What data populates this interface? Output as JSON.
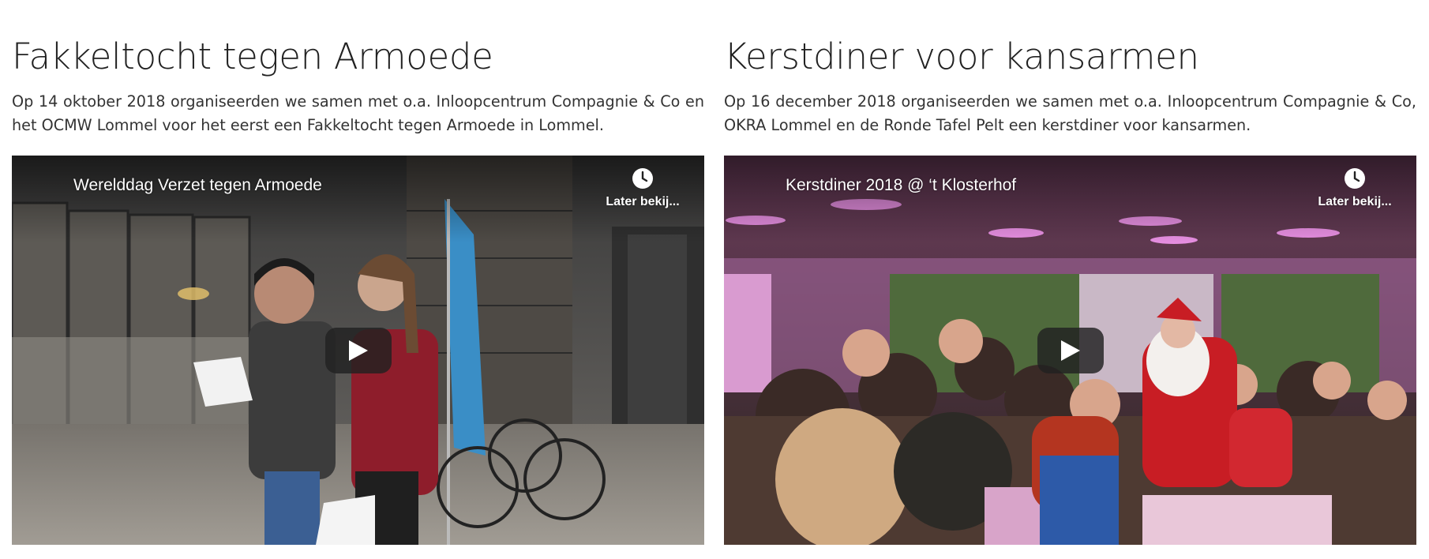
{
  "articles": [
    {
      "title": "Fakkeltocht tegen Armoede",
      "description": "Op 14 oktober 2018 organiseerden we samen met o.a. Inloopcentrum Compagnie & Co en het OCMW Lommel voor het eerst een Fakkeltocht tegen Armoede in Lommel.",
      "video": {
        "title": "Werelddag Verzet tegen Armoede",
        "watch_later_label": "Later bekij...",
        "watch_later_icon": "clock-icon",
        "play_icon": "play-icon"
      }
    },
    {
      "title": "Kerstdiner voor kansarmen",
      "description": "Op 16 december 2018 organiseerden we samen met o.a. Inloopcentrum Compagnie & Co, OKRA Lommel en de Ronde Tafel Pelt een kerstdiner voor kansarmen.",
      "video": {
        "title": "Kerstdiner 2018 @ ‘t Klosterhof",
        "watch_later_label": "Later bekij...",
        "watch_later_icon": "clock-icon",
        "play_icon": "play-icon"
      }
    }
  ],
  "colors": {
    "play_button_bg": "#212121",
    "heading": "#212121",
    "body_text": "#333333",
    "video1_tone": "#4a4a4a",
    "video2_tone": "#b0468f"
  }
}
